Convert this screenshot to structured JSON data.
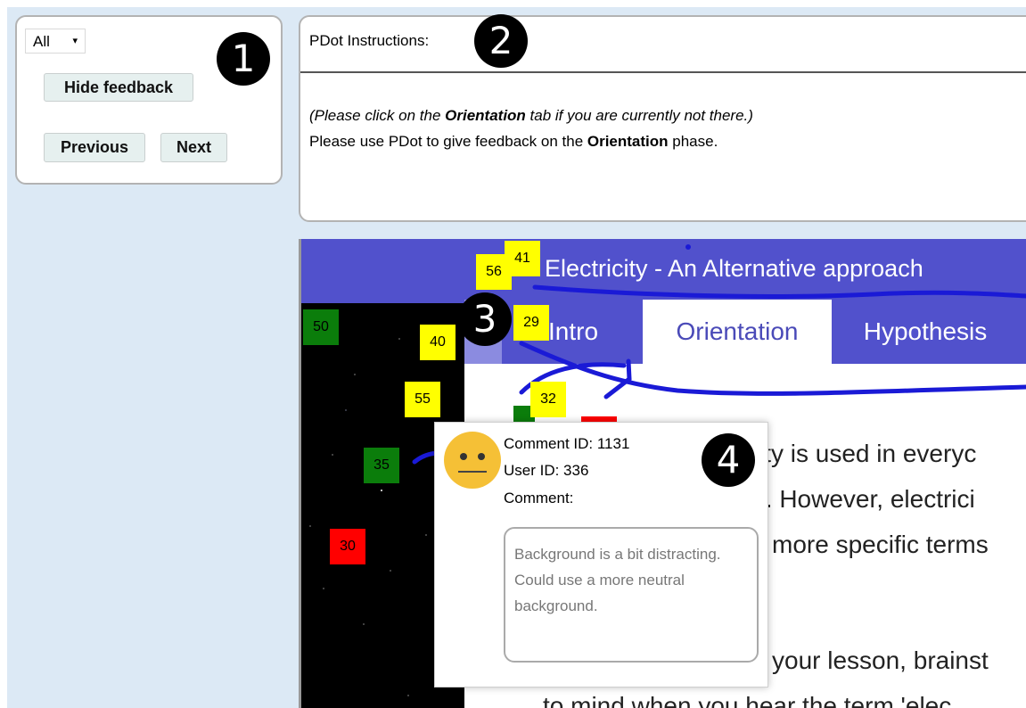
{
  "controls": {
    "filter_value": "All",
    "hide_feedback_label": "Hide feedback",
    "previous_label": "Previous",
    "next_label": "Next"
  },
  "badges": [
    "1",
    "2",
    "3",
    "4"
  ],
  "instructions": {
    "title": "PDot Instructions:",
    "line1_prefix": "(Please click on the ",
    "line1_bold": "Orientation",
    "line1_suffix": " tab if you are currently not there.)",
    "line2_prefix": "Please use PDot to give feedback on the ",
    "line2_bold": "Orientation",
    "line2_suffix": " phase."
  },
  "lesson": {
    "title": "Electricity - An Alternative approach",
    "tabs": [
      "Intro",
      "Orientation",
      "Hypothesis"
    ],
    "active_tab": "Orientation",
    "content_lines": [
      "ity is used in everyc",
      "t. However, electrici",
      "more specific terms",
      "your lesson, brainst",
      "to mind when you hear the term 'elec"
    ]
  },
  "feedback_markers": [
    {
      "id": "56",
      "color": "yellow"
    },
    {
      "id": "41",
      "color": "yellow"
    },
    {
      "id": "29",
      "color": "yellow"
    },
    {
      "id": "50",
      "color": "green"
    },
    {
      "id": "40",
      "color": "yellow"
    },
    {
      "id": "55",
      "color": "yellow"
    },
    {
      "id": "32",
      "color": "yellow"
    },
    {
      "id": "35",
      "color": "green"
    },
    {
      "id": "30",
      "color": "red"
    }
  ],
  "tooltip": {
    "comment_id_label": "Comment ID: 1131",
    "user_id_label": "User ID: 336",
    "comment_label": "Comment:",
    "comment_text": "Background is a bit distracting. Could use a more neutral background.",
    "mood_icon": "neutral-face-icon"
  },
  "colors": {
    "header_blue": "#5151cc",
    "page_bg": "#dce9f5",
    "marker_yellow": "#ffff00",
    "marker_green": "#0b7d0b",
    "marker_red": "#ff0000",
    "annotation_ink": "#1a1ad6"
  }
}
